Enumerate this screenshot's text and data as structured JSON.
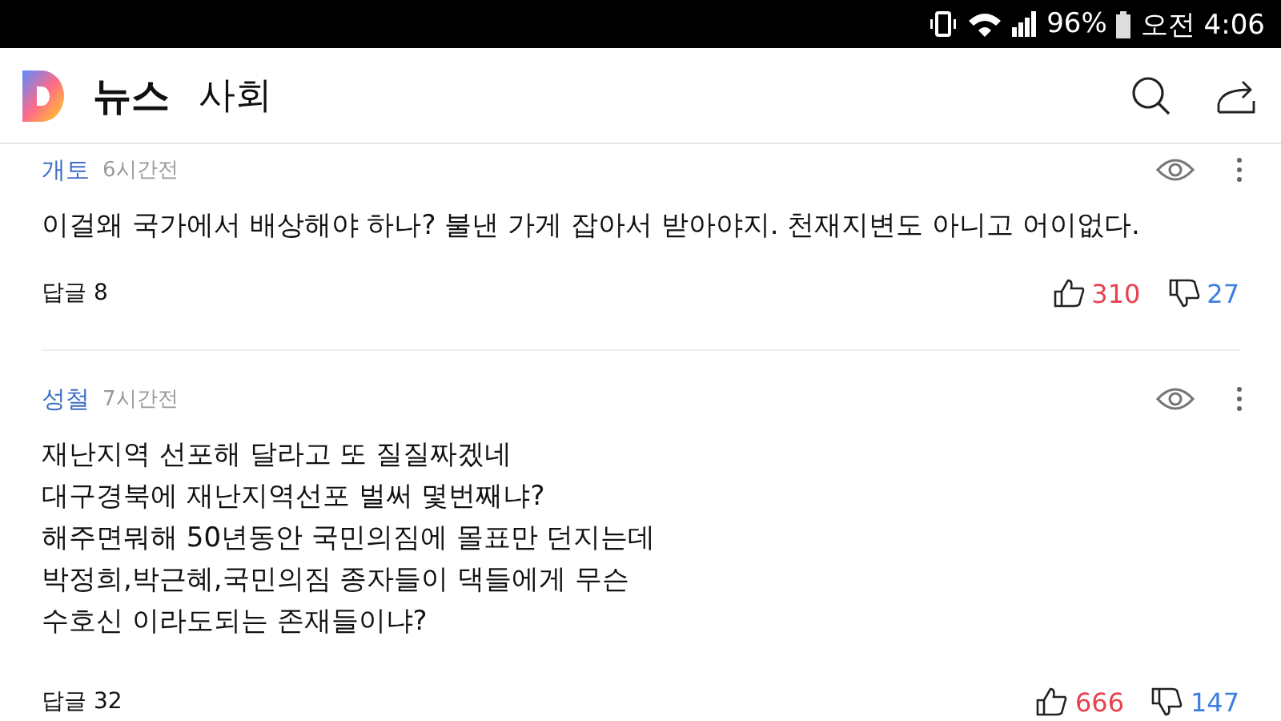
{
  "status_bar": {
    "battery": "96%",
    "time": "오전 4:06"
  },
  "header": {
    "section": "뉴스",
    "category": "사회"
  },
  "comments": [
    {
      "author": "개토",
      "time": "6시간전",
      "lines": [
        "이걸왜 국가에서 배상해야 하나? 불낸 가게 잡아서 받아야지. 천재지변도 아니고 어이없다."
      ],
      "replies": "답글 8",
      "likes": "310",
      "dislikes": "27"
    },
    {
      "author": "성철",
      "time": "7시간전",
      "lines": [
        "재난지역 선포해 달라고 또 질질짜겠네",
        "대구경북에 재난지역선포 벌써 몇번째냐?",
        "해주면뭐해 50년동안 국민의짐에 몰표만 던지는데",
        "박정희,박근혜,국민의짐 종자들이 댁들에게 무슨",
        "수호신 이라도되는 존재들이냐?"
      ],
      "replies": "답글 32",
      "likes": "666",
      "dislikes": "147"
    }
  ]
}
